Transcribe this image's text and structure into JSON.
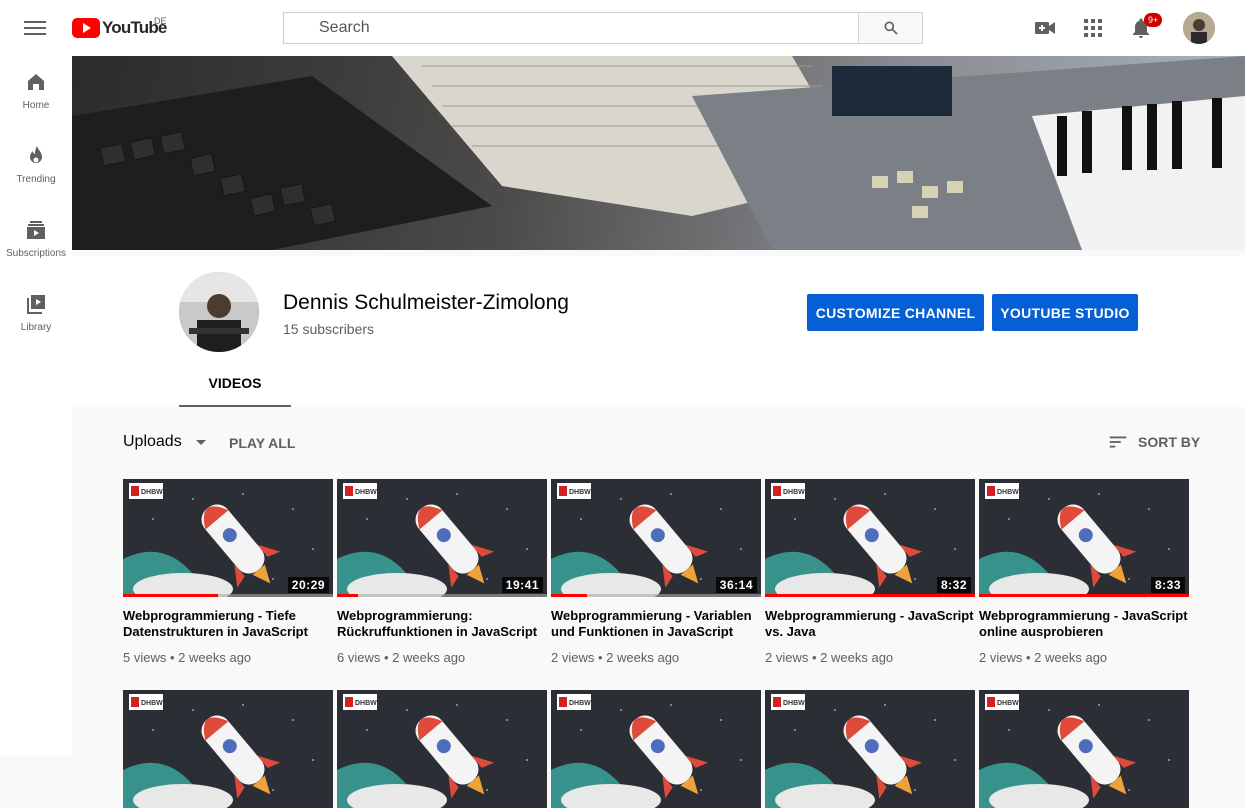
{
  "header": {
    "logo_text": "YouTube",
    "country": "DE",
    "search_placeholder": "Search",
    "notification_count": "9+"
  },
  "guide": [
    {
      "label": "Home",
      "icon": "home-icon"
    },
    {
      "label": "Trending",
      "icon": "flame-icon"
    },
    {
      "label": "Subscriptions",
      "icon": "subscriptions-icon"
    },
    {
      "label": "Library",
      "icon": "library-icon"
    }
  ],
  "channel": {
    "name": "Dennis Schulmeister-Zimolong",
    "subscribers": "15 subscribers",
    "customize_label": "CUSTOMIZE CHANNEL",
    "studio_label": "YOUTUBE STUDIO",
    "tab_videos": "VIDEOS"
  },
  "content": {
    "uploads_label": "Uploads",
    "play_all_label": "PLAY ALL",
    "sort_label": "SORT BY"
  },
  "videos": [
    {
      "title": "Webprogrammierung - Tiefe Datenstrukturen in JavaScript",
      "duration": "20:29",
      "views": "5 views",
      "age": "2 weeks ago",
      "watched": 0.45
    },
    {
      "title": "Webprogrammierung: Rückruffunktionen in JavaScript",
      "duration": "19:41",
      "views": "6 views",
      "age": "2 weeks ago",
      "watched": 0.1
    },
    {
      "title": "Webprogrammierung - Variablen und Funktionen in JavaScript",
      "duration": "36:14",
      "views": "2 views",
      "age": "2 weeks ago",
      "watched": 0.17
    },
    {
      "title": "Webprogrammierung - JavaScript vs. Java",
      "duration": "8:32",
      "views": "2 views",
      "age": "2 weeks ago",
      "watched": 1.0
    },
    {
      "title": "Webprogrammierung - JavaScript online ausprobieren",
      "duration": "8:33",
      "views": "2 views",
      "age": "2 weeks ago",
      "watched": 1.0
    }
  ],
  "colors": {
    "accent": "#065fd4",
    "red": "#ff0000"
  }
}
